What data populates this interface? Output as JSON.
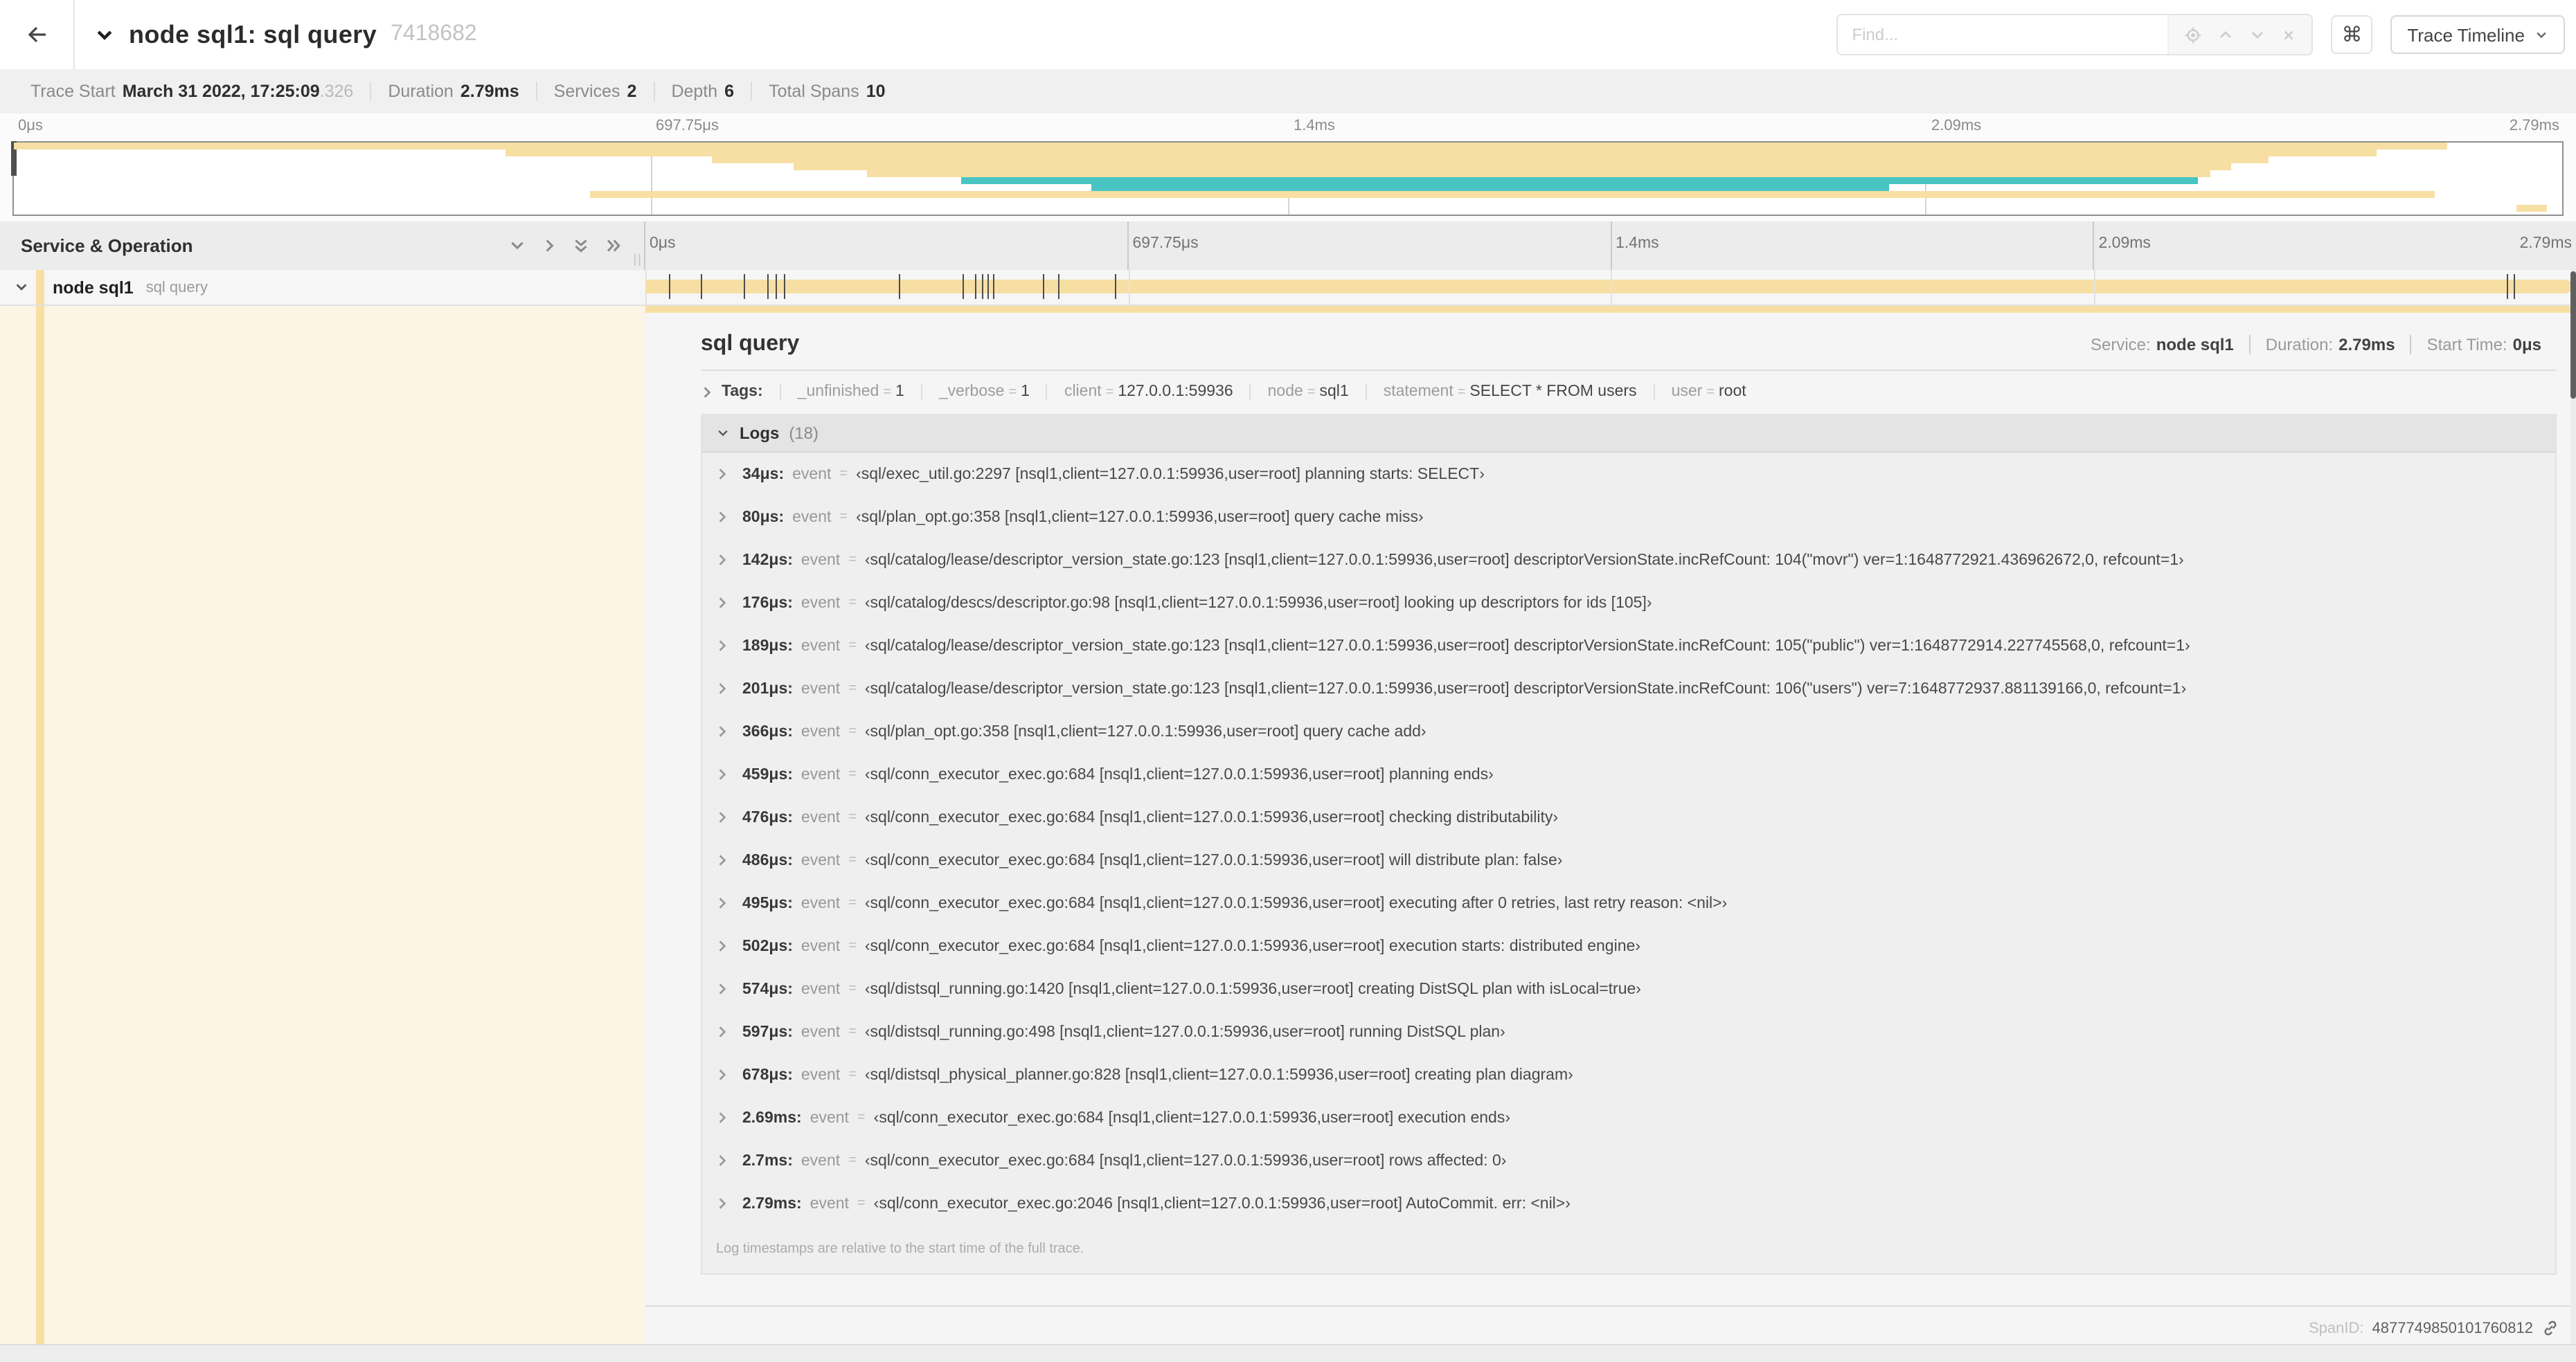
{
  "header": {
    "title": "node sql1: sql query",
    "trace_id_short": "7418682",
    "find_placeholder": "Find...",
    "cmd_glyph": "⌘",
    "trace_timeline_label": "Trace Timeline"
  },
  "infobar": {
    "items": [
      {
        "label": "Trace Start",
        "value": "March 31 2022, 17:25:09",
        "suffix": ".326"
      },
      {
        "label": "Duration",
        "value": "2.79ms"
      },
      {
        "label": "Services",
        "value": "2"
      },
      {
        "label": "Depth",
        "value": "6"
      },
      {
        "label": "Total Spans",
        "value": "10"
      }
    ]
  },
  "timeline": {
    "duration_us": 2790,
    "ruler_labels": [
      {
        "text": "0μs",
        "pos": 0
      },
      {
        "text": "697.75μs",
        "pos": 25
      },
      {
        "text": "1.4ms",
        "pos": 50
      },
      {
        "text": "2.09ms",
        "pos": 75
      },
      {
        "text": "2.79ms",
        "pos": 100
      }
    ],
    "grid_positions": [
      25,
      50,
      75
    ],
    "colors": {
      "tan": "#f7dfa4",
      "teal": "#48c5c2",
      "cream": "#fcf5e5"
    },
    "minimap_bars": [
      {
        "row": 0,
        "start": 0,
        "end": 95.5,
        "color": "tan"
      },
      {
        "row": 1,
        "start": 19.3,
        "end": 92.7,
        "color": "tan"
      },
      {
        "row": 2,
        "start": 27.4,
        "end": 88.5,
        "color": "tan"
      },
      {
        "row": 3,
        "start": 30.6,
        "end": 87.0,
        "color": "tan"
      },
      {
        "row": 4,
        "start": 33.5,
        "end": 86.2,
        "color": "tan"
      },
      {
        "row": 5,
        "start": 37.2,
        "end": 85.7,
        "color": "teal"
      },
      {
        "row": 6,
        "start": 42.3,
        "end": 73.6,
        "color": "teal"
      },
      {
        "row": 7,
        "start": 22.6,
        "end": 95.0,
        "color": "tan"
      },
      {
        "row": 9,
        "start": 98.2,
        "end": 99.4,
        "color": "tan"
      }
    ]
  },
  "span_table": {
    "header_label": "Service & Operation",
    "row": {
      "service": "node sql1",
      "operation": "sql query"
    }
  },
  "detail": {
    "title": "sql query",
    "stats": [
      {
        "label": "Service:",
        "value": "node sql1"
      },
      {
        "label": "Duration:",
        "value": "2.79ms"
      },
      {
        "label": "Start Time:",
        "value": "0μs"
      }
    ],
    "tags_label": "Tags:",
    "tags": [
      {
        "key": "_unfinished",
        "value": "1"
      },
      {
        "key": "_verbose",
        "value": "1"
      },
      {
        "key": "client",
        "value": "127.0.0.1:59936"
      },
      {
        "key": "node",
        "value": "sql1"
      },
      {
        "key": "statement",
        "value": "SELECT * FROM users"
      },
      {
        "key": "user",
        "value": "root"
      }
    ],
    "logs_label": "Logs",
    "logs_count": "(18)",
    "log_field_key": "event",
    "logs": [
      {
        "t": "34μs:",
        "t_us": 34,
        "msg": "‹sql/exec_util.go:2297 [nsql1,client=127.0.0.1:59936,user=root] planning starts: SELECT›"
      },
      {
        "t": "80μs:",
        "t_us": 80,
        "msg": "‹sql/plan_opt.go:358 [nsql1,client=127.0.0.1:59936,user=root] query cache miss›"
      },
      {
        "t": "142μs:",
        "t_us": 142,
        "msg": "‹sql/catalog/lease/descriptor_version_state.go:123 [nsql1,client=127.0.0.1:59936,user=root] descriptorVersionState.incRefCount: 104(\"movr\") ver=1:1648772921.436962672,0, refcount=1›"
      },
      {
        "t": "176μs:",
        "t_us": 176,
        "msg": "‹sql/catalog/descs/descriptor.go:98 [nsql1,client=127.0.0.1:59936,user=root] looking up descriptors for ids [105]›"
      },
      {
        "t": "189μs:",
        "t_us": 189,
        "msg": "‹sql/catalog/lease/descriptor_version_state.go:123 [nsql1,client=127.0.0.1:59936,user=root] descriptorVersionState.incRefCount: 105(\"public\") ver=1:1648772914.227745568,0, refcount=1›"
      },
      {
        "t": "201μs:",
        "t_us": 201,
        "msg": "‹sql/catalog/lease/descriptor_version_state.go:123 [nsql1,client=127.0.0.1:59936,user=root] descriptorVersionState.incRefCount: 106(\"users\") ver=7:1648772937.881139166,0, refcount=1›"
      },
      {
        "t": "366μs:",
        "t_us": 366,
        "msg": "‹sql/plan_opt.go:358 [nsql1,client=127.0.0.1:59936,user=root] query cache add›"
      },
      {
        "t": "459μs:",
        "t_us": 459,
        "msg": "‹sql/conn_executor_exec.go:684 [nsql1,client=127.0.0.1:59936,user=root] planning ends›"
      },
      {
        "t": "476μs:",
        "t_us": 476,
        "msg": "‹sql/conn_executor_exec.go:684 [nsql1,client=127.0.0.1:59936,user=root] checking distributability›"
      },
      {
        "t": "486μs:",
        "t_us": 486,
        "msg": "‹sql/conn_executor_exec.go:684 [nsql1,client=127.0.0.1:59936,user=root] will distribute plan: false›"
      },
      {
        "t": "495μs:",
        "t_us": 495,
        "msg": "‹sql/conn_executor_exec.go:684 [nsql1,client=127.0.0.1:59936,user=root] executing after 0 retries, last retry reason: <nil>›"
      },
      {
        "t": "502μs:",
        "t_us": 502,
        "msg": "‹sql/conn_executor_exec.go:684 [nsql1,client=127.0.0.1:59936,user=root] execution starts: distributed engine›"
      },
      {
        "t": "574μs:",
        "t_us": 574,
        "msg": "‹sql/distsql_running.go:1420 [nsql1,client=127.0.0.1:59936,user=root] creating DistSQL plan with isLocal=true›"
      },
      {
        "t": "597μs:",
        "t_us": 597,
        "msg": "‹sql/distsql_running.go:498 [nsql1,client=127.0.0.1:59936,user=root] running DistSQL plan›"
      },
      {
        "t": "678μs:",
        "t_us": 678,
        "msg": "‹sql/distsql_physical_planner.go:828 [nsql1,client=127.0.0.1:59936,user=root] creating plan diagram›"
      },
      {
        "t": "2.69ms:",
        "t_us": 2690,
        "msg": "‹sql/conn_executor_exec.go:684 [nsql1,client=127.0.0.1:59936,user=root] execution ends›"
      },
      {
        "t": "2.7ms:",
        "t_us": 2700,
        "msg": "‹sql/conn_executor_exec.go:684 [nsql1,client=127.0.0.1:59936,user=root] rows affected: 0›"
      },
      {
        "t": "2.79ms:",
        "t_us": 2790,
        "msg": "‹sql/conn_executor_exec.go:2046 [nsql1,client=127.0.0.1:59936,user=root] AutoCommit. err: <nil>›"
      }
    ],
    "footnote": "Log timestamps are relative to the start time of the full trace.",
    "spanid_label": "SpanID:",
    "spanid": "4877749850101760812"
  }
}
